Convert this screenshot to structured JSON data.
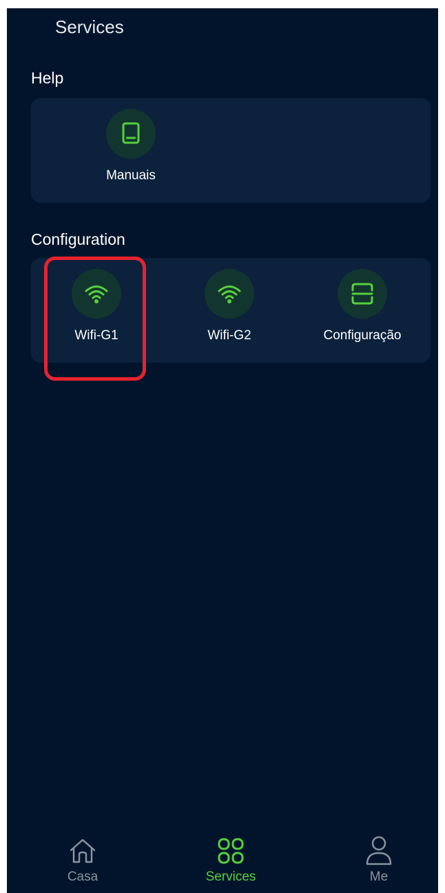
{
  "header": {
    "title": "Services"
  },
  "help": {
    "title": "Help",
    "items": [
      {
        "label": "Manuais",
        "icon": "book-icon"
      }
    ]
  },
  "configuration": {
    "title": "Configuration",
    "items": [
      {
        "label": "Wifi-G1",
        "icon": "wifi-icon"
      },
      {
        "label": "Wifi-G2",
        "icon": "wifi-icon"
      },
      {
        "label": "Configuração",
        "icon": "scan-icon"
      }
    ]
  },
  "bottom_nav": {
    "items": [
      {
        "label": "Casa",
        "icon": "home-icon",
        "active": false
      },
      {
        "label": "Services",
        "icon": "grid-icon",
        "active": true
      },
      {
        "label": "Me",
        "icon": "user-icon",
        "active": false
      }
    ]
  },
  "colors": {
    "background": "#02142b",
    "card": "#0b213c",
    "accent": "#56d03e",
    "inactive": "#8a939f",
    "highlight": "#e8232e"
  }
}
